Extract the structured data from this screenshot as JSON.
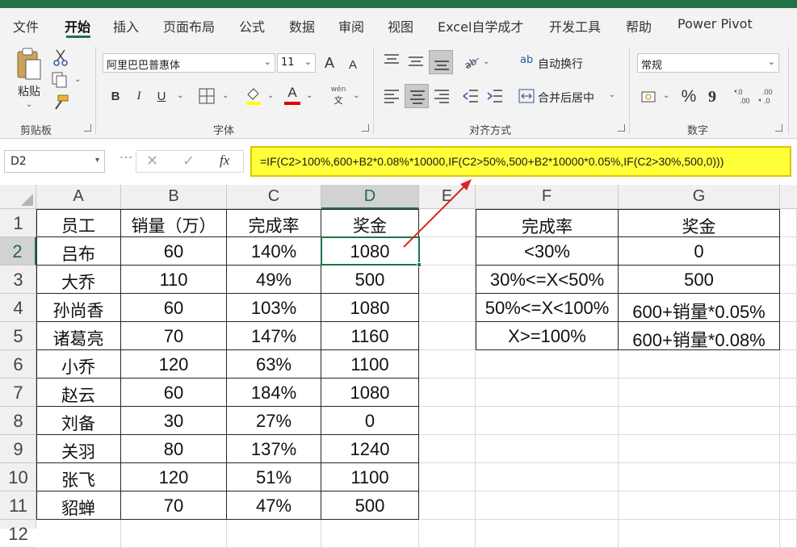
{
  "ribbon_tabs": [
    "文件",
    "开始",
    "插入",
    "页面布局",
    "公式",
    "数据",
    "审阅",
    "视图",
    "Excel自学成才",
    "开发工具",
    "帮助",
    "Power Pivot"
  ],
  "active_tab": "开始",
  "clipboard": {
    "paste_label": "粘贴",
    "group_label": "剪贴板"
  },
  "font": {
    "name": "阿里巴巴普惠体",
    "size": "11",
    "group_label": "字体",
    "bold": "B",
    "italic": "I",
    "underline": "U",
    "font_color_glyph": "A",
    "grow_glyph": "A",
    "shrink_glyph": "A",
    "phonetic_top": "wén",
    "phonetic_bottom": "文"
  },
  "alignment": {
    "wrap_text": "自动换行",
    "merge_center": "合并后居中",
    "group_label": "对齐方式",
    "wrap_glyph": "ab"
  },
  "number": {
    "format": "常规",
    "group_label": "数字",
    "percent": "%",
    "comma": "9"
  },
  "formula_bar": {
    "name_box": "D2",
    "fx": "fx",
    "formula": "=IF(C2>100%,600+B2*0.08%*10000,IF(C2>50%,500+B2*10000*0.05%,IF(C2>30%,500,0)))"
  },
  "columns": [
    "A",
    "B",
    "C",
    "D",
    "E",
    "F",
    "G"
  ],
  "selected_column": "D",
  "rows": [
    "1",
    "2",
    "3",
    "4",
    "5",
    "6",
    "7",
    "8",
    "9",
    "10",
    "11",
    "12"
  ],
  "selected_row": "2",
  "table": {
    "headers": [
      "员工",
      "销量（万）",
      "完成率",
      "奖金"
    ],
    "rows": [
      [
        "吕布",
        "60",
        "140%",
        "1080"
      ],
      [
        "大乔",
        "110",
        "49%",
        "500"
      ],
      [
        "孙尚香",
        "60",
        "103%",
        "1080"
      ],
      [
        "诸葛亮",
        "70",
        "147%",
        "1160"
      ],
      [
        "小乔",
        "120",
        "63%",
        "1100"
      ],
      [
        "赵云",
        "60",
        "184%",
        "1080"
      ],
      [
        "刘备",
        "30",
        "27%",
        "0"
      ],
      [
        "关羽",
        "80",
        "137%",
        "1240"
      ],
      [
        "张飞",
        "120",
        "51%",
        "1100"
      ],
      [
        "貂蝉",
        "70",
        "47%",
        "500"
      ]
    ]
  },
  "rules_table": {
    "headers": [
      "完成率",
      "奖金"
    ],
    "rows": [
      [
        "<30%",
        "0"
      ],
      [
        "30%<=X<50%",
        "500"
      ],
      [
        "50%<=X<100%",
        "600+销量*0.05%"
      ],
      [
        "X>=100%",
        "600+销量*0.08%"
      ]
    ]
  },
  "colors": {
    "excel_green": "#217346",
    "highlight": "#ffff3a",
    "arrow": "#e02020"
  }
}
